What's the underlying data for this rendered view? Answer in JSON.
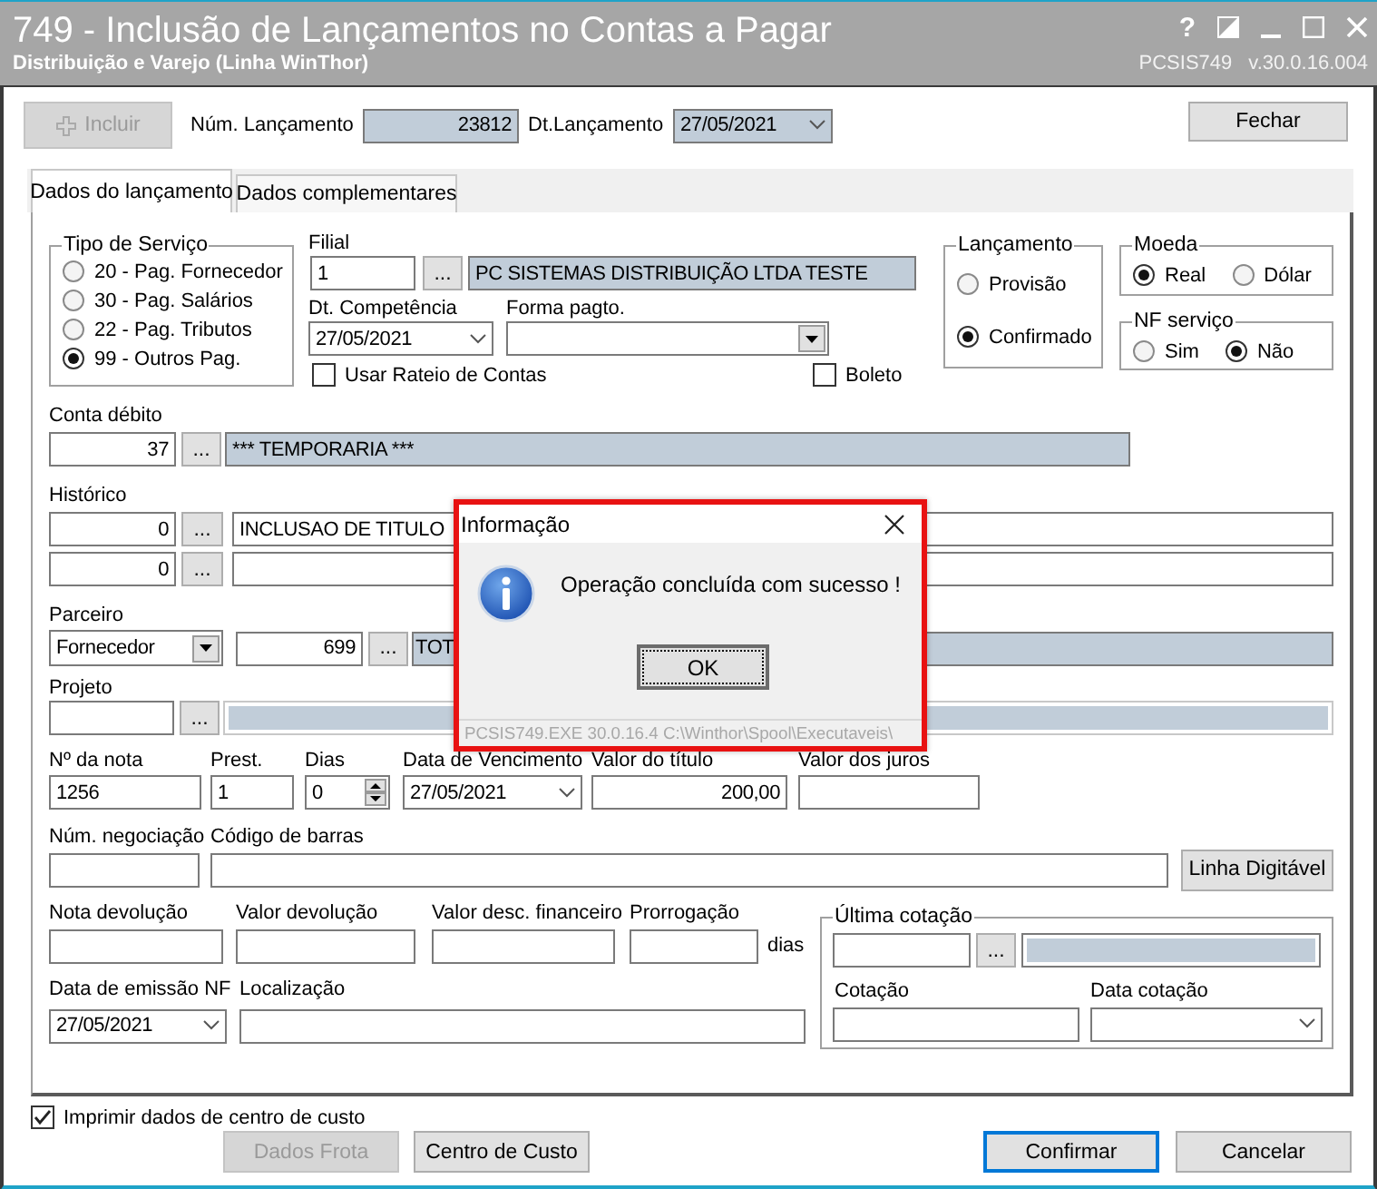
{
  "window": {
    "title": "749 - Inclusão de Lançamentos no Contas a Pagar",
    "subtitle": "Distribuição e Varejo (Linha WinThor)",
    "help": "?",
    "program": "PCSIS749",
    "version": "v.30.0.16.004"
  },
  "toolbar": {
    "add_button": {
      "label": "Incluir",
      "disabled": true
    },
    "entry_number": {
      "label": "Núm. Lançamento",
      "value": "23812"
    },
    "entry_date": {
      "label": "Dt.Lançamento",
      "value": "27/05/2021"
    },
    "close_button": {
      "label": "Fechar"
    }
  },
  "tabs": [
    {
      "label": "Dados do lançamento",
      "selected": true
    },
    {
      "label": "Dados complementares",
      "selected": false
    }
  ],
  "service_type": {
    "title": "Tipo de Serviço",
    "options": [
      {
        "label": "20 - Pag. Fornecedor",
        "selected": false
      },
      {
        "label": "30 - Pag. Salários",
        "selected": false
      },
      {
        "label": "22 - Pag. Tributos",
        "selected": false
      },
      {
        "label": "99 - Outros Pag.",
        "selected": true
      }
    ]
  },
  "branch": {
    "label": "Filial",
    "code": "1",
    "browse": "...",
    "name": "PC SISTEMAS DISTRIBUIÇÃO LTDA TESTE"
  },
  "competence_date": {
    "label": "Dt. Competência",
    "value": "27/05/2021"
  },
  "payment_form": {
    "label": "Forma pagto."
  },
  "use_apportionment": {
    "label": "Usar Rateio de Contas",
    "checked": false
  },
  "boleto": {
    "label": "Boleto",
    "checked": false
  },
  "entry_kind": {
    "title": "Lançamento",
    "options": [
      {
        "label": "Provisão",
        "selected": false
      },
      {
        "label": "Confirmado",
        "selected": true
      }
    ]
  },
  "currency": {
    "title": "Moeda",
    "options": [
      {
        "label": "Real",
        "selected": true
      },
      {
        "label": "Dólar",
        "selected": false
      }
    ]
  },
  "service_invoice": {
    "title": "NF serviço",
    "options": [
      {
        "label": "Sim",
        "selected": false
      },
      {
        "label": "Não",
        "selected": true
      }
    ]
  },
  "debit_account": {
    "label": "Conta débito",
    "code": "37",
    "browse": "...",
    "name": "*** TEMPORARIA ***"
  },
  "history": {
    "label": "Histórico",
    "lines": [
      {
        "code": "0",
        "browse": "...",
        "text": "INCLUSAO DE TITULO"
      },
      {
        "code": "0",
        "browse": "..."
      }
    ]
  },
  "partner": {
    "label": "Parceiro",
    "type": "Fornecedor",
    "code": "699",
    "browse": "...",
    "name": "TOT"
  },
  "project": {
    "label": "Projeto",
    "browse": "..."
  },
  "invoice_row": [
    {
      "label": "Nº da nota",
      "value": "1256",
      "kind": "text"
    },
    {
      "label": "Prest.",
      "value": "1",
      "kind": "text"
    },
    {
      "label": "Dias",
      "value": "0",
      "kind": "spin"
    },
    {
      "label": "Data de Vencimento",
      "value": "27/05/2021",
      "kind": "date"
    },
    {
      "label": "Valor do título",
      "value": "200,00",
      "kind": "amount"
    },
    {
      "label": "Valor dos juros",
      "kind": "text"
    }
  ],
  "negotiation": {
    "label": "Núm. negociação"
  },
  "barcode": {
    "label": "Código de barras",
    "button": "Linha Digitável"
  },
  "returns_row": [
    {
      "label": "Nota devolução"
    },
    {
      "label": "Valor devolução"
    },
    {
      "label": "Valor desc. financeiro"
    },
    {
      "label": "Prorrogação",
      "unit": "dias"
    }
  ],
  "last_quote": {
    "title": "Última cotação",
    "browse": "...",
    "quote_label": "Cotação",
    "date_label": "Data cotação"
  },
  "issue_date": {
    "label": "Data de emissão NF",
    "value": "27/05/2021"
  },
  "location": {
    "label": "Localização"
  },
  "print_cost_center": {
    "label": "Imprimir dados de centro de custo",
    "checked": true
  },
  "buttons": [
    {
      "label": "Dados Frota",
      "disabled": true,
      "default": false
    },
    {
      "label": "Centro de Custo",
      "disabled": false,
      "default": false
    },
    {
      "label": "Confirmar",
      "disabled": false,
      "default": true
    },
    {
      "label": "Cancelar",
      "disabled": false,
      "default": false
    }
  ],
  "dialog": {
    "title": "Informação",
    "message": "Operação concluída com sucesso !",
    "ok": "OK",
    "footer": "PCSIS749.EXE 30.0.16.4 C:\\Winthor\\Spool\\Executaveis\\"
  }
}
